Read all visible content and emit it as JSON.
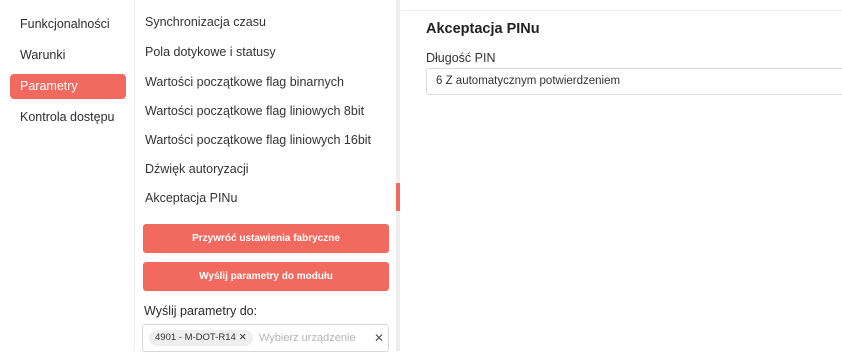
{
  "nav": {
    "items": [
      {
        "label": "Funkcjonalności",
        "active": false
      },
      {
        "label": "Warunki",
        "active": false
      },
      {
        "label": "Parametry",
        "active": true
      },
      {
        "label": "Kontrola dostępu",
        "active": false
      }
    ]
  },
  "menu": {
    "items": [
      "Synchronizacja czasu",
      "Pola dotykowe i statusy",
      "Wartości początkowe flag binarnych",
      "Wartości początkowe flag liniowych 8bit",
      "Wartości początkowe flag liniowych 16bit",
      "Dźwięk autoryzacji",
      "Akceptacja PINu"
    ]
  },
  "actions": {
    "reset_label": "Przywróć ustawienia fabryczne",
    "send_label": "Wyślij parametry do modułu"
  },
  "send_to": {
    "label": "Wyślij parametry do:",
    "selected_device": "4901 - M-DOT-R14",
    "tag_remove": "✕",
    "placeholder": "Wybierz urządzenie",
    "clear": "✕"
  },
  "content": {
    "title": "Akceptacja PINu",
    "field_label": "Długość PIN",
    "field_value": "6 Z automatycznym potwierdzeniem"
  },
  "colors": {
    "accent": "#f26a5f",
    "scroll_track": "#eeeeee"
  }
}
